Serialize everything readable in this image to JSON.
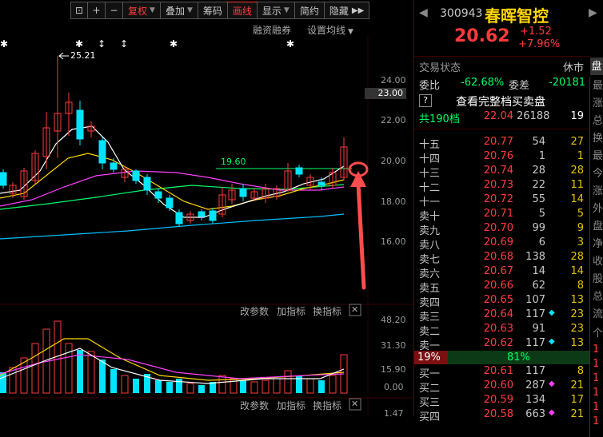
{
  "toolbar": {
    "items": [
      "复权",
      "叠加",
      "筹码",
      "画线",
      "显示",
      "简约",
      "隐藏"
    ],
    "fuquan_label": "复权",
    "diejia_label": "叠加",
    "chouma_label": "筹码",
    "huaxian_label": "画线",
    "xianshi_label": "显示",
    "jianyue_label": "简约",
    "yincang_label": "隐藏"
  },
  "main_chart": {
    "rongzi_label": "融资融券",
    "ma_settings_label": "设置均线",
    "high_marker": "25.21",
    "level_line_label": "19.60",
    "y_ticks": [
      "24.00",
      "23.00",
      "22.00",
      "20.00",
      "18.00",
      "16.00"
    ],
    "highlight_tick": "23.00"
  },
  "indicator_bar_1": {
    "gaicanshu": "改参数",
    "jiazhibiao": "加指标",
    "huanzhibiao": "换指标"
  },
  "volume_chart": {
    "y_ticks": [
      "48.20",
      "31.30",
      "15.90",
      "0.00"
    ]
  },
  "indicator_bar_2": {
    "gaicanshu": "改参数",
    "jiazhibiao": "加指标",
    "huanzhibiao": "换指标",
    "bottom_tick": "1.47"
  },
  "stock": {
    "code": "300943",
    "name": "春晖智控",
    "price": "20.62",
    "change": "+1.52",
    "change_pct": "+7.96%"
  },
  "status": {
    "label": "交易状态",
    "value": "休市",
    "tab": "盘"
  },
  "weibi": {
    "label": "委比",
    "value": "-62.68%",
    "diff_label": "委差",
    "diff_value": "-20181"
  },
  "full_orderbook_link": "查看完整档买卖盘",
  "order_book_summary": {
    "label": "共190档",
    "price": "22.04",
    "volume": "26188",
    "count": "19"
  },
  "asks": [
    {
      "label": "十五",
      "price": "20.77",
      "vol": "54",
      "cnt": "27"
    },
    {
      "label": "十四",
      "price": "20.76",
      "vol": "1",
      "cnt": "1"
    },
    {
      "label": "十三",
      "price": "20.74",
      "vol": "28",
      "cnt": "28"
    },
    {
      "label": "十二",
      "price": "20.73",
      "vol": "22",
      "cnt": "11"
    },
    {
      "label": "十一",
      "price": "20.72",
      "vol": "55",
      "cnt": "14"
    },
    {
      "label": "卖十",
      "price": "20.71",
      "vol": "5",
      "cnt": "5"
    },
    {
      "label": "卖九",
      "price": "20.70",
      "vol": "99",
      "cnt": "9"
    },
    {
      "label": "卖八",
      "price": "20.69",
      "vol": "6",
      "cnt": "3"
    },
    {
      "label": "卖七",
      "price": "20.68",
      "vol": "138",
      "cnt": "28"
    },
    {
      "label": "卖六",
      "price": "20.67",
      "vol": "14",
      "cnt": "14"
    },
    {
      "label": "卖五",
      "price": "20.66",
      "vol": "62",
      "cnt": "8"
    },
    {
      "label": "卖四",
      "price": "20.65",
      "vol": "107",
      "cnt": "13"
    },
    {
      "label": "卖三",
      "price": "20.64",
      "vol": "117",
      "cnt": "23"
    },
    {
      "label": "卖二",
      "price": "20.63",
      "vol": "91",
      "cnt": "23"
    },
    {
      "label": "卖一",
      "price": "20.62",
      "vol": "117",
      "cnt": "13"
    }
  ],
  "ratio_bar": {
    "sell_pct": "19%",
    "buy_pct": "81%"
  },
  "bids": [
    {
      "label": "买一",
      "price": "20.61",
      "vol": "117",
      "cnt": "8"
    },
    {
      "label": "买二",
      "price": "20.60",
      "vol": "287",
      "cnt": "21"
    },
    {
      "label": "买三",
      "price": "20.59",
      "vol": "134",
      "cnt": "17"
    },
    {
      "label": "买四",
      "price": "20.58",
      "vol": "663",
      "cnt": "21"
    }
  ],
  "edge_column": [
    "最",
    "涨",
    "总",
    "换",
    "最",
    "今",
    "涨",
    "外",
    "盘",
    "净",
    "收",
    "股",
    "总",
    "流",
    "个",
    "1",
    "1",
    "1",
    "1",
    "1",
    "1"
  ],
  "colors": {
    "up": "#ff3b3b",
    "down": "#00e5ff",
    "ma5": "#ffffff",
    "ma10": "#ffd700",
    "ma20": "#ff40ff",
    "ma60": "#00ff66",
    "ma120": "#00bfff"
  }
}
